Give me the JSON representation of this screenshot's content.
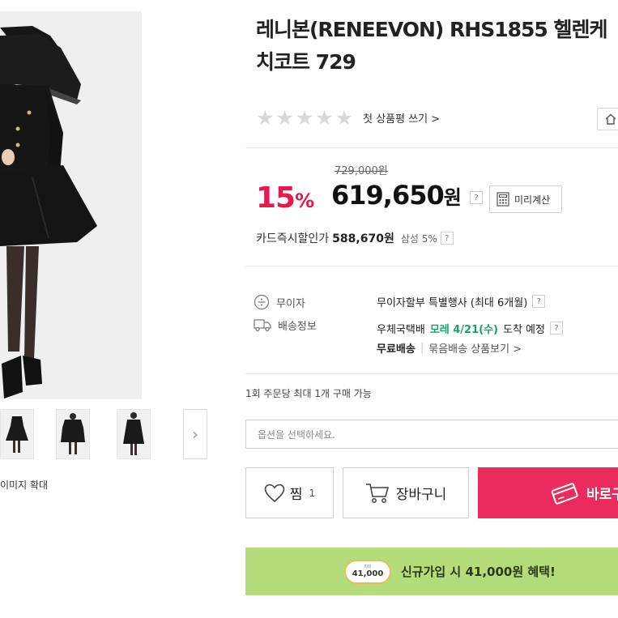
{
  "gallery": {
    "zoom_label": "이미지 확대",
    "next_icon": "chevron-right-icon",
    "thumbnail_count": 3
  },
  "product": {
    "title_line1": "레니본(RENEEVON) RHS1855 헬렌케",
    "title_line2": "치코트 729",
    "review_link": "첫 상품평 쓰기 >",
    "rating_stars": 0,
    "rating_max": 5
  },
  "price": {
    "original": "729,000원",
    "discount_number": "15",
    "discount_unit": "%",
    "sale_number": "619,650",
    "sale_unit": "원",
    "help_mark": "?",
    "calc_button_label": "미리계산",
    "card_label": "카드즉시할인가",
    "card_price": "588,670원",
    "card_name": "삼성 5%"
  },
  "shipping": {
    "label_interest": "무이자",
    "label_delivery": "배송정보",
    "interest_text": "무이자할부 특별행사 (최대 6개월)",
    "courier": "우체국택배",
    "arrival_date": "모레 4/21(수)",
    "arrival_suffix": "도착 예정",
    "free_shipping": "무료배송",
    "bundle_link": "묶음배송 상품보기 >"
  },
  "order": {
    "limit_text": "1회 주문당 최대 1개 구매 가능",
    "option_placeholder": "옵션을 선택하세요.",
    "wish_label": "찜",
    "wish_count": "1",
    "cart_label": "장바구니",
    "buy_label": "바로구매"
  },
  "promo": {
    "coin_top": "최대",
    "coin_amount": "41,000",
    "text": "신규가입 시 41,000원 혜택!"
  },
  "colors": {
    "accent_pink": "#e5194e",
    "buy_button": "#ea2b5b",
    "green_text": "#1aa06d",
    "promo_bg": "#b4dc7a"
  }
}
